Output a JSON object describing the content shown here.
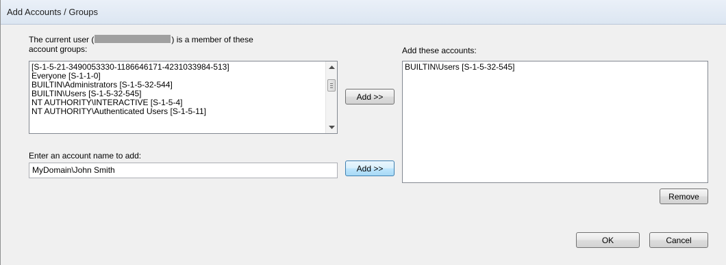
{
  "window": {
    "title": "Add Accounts / Groups"
  },
  "current_groups": {
    "label_prefix": "The current user (",
    "label_suffix": ") is a member of these",
    "label_line2": "account groups:",
    "items": [
      "[S-1-5-21-3490053330-1186646171-4231033984-513]",
      "Everyone [S-1-1-0]",
      "BUILTIN\\Administrators [S-1-5-32-544]",
      "BUILTIN\\Users [S-1-5-32-545]",
      "NT AUTHORITY\\INTERACTIVE [S-1-5-4]",
      "NT AUTHORITY\\Authenticated Users [S-1-5-11]"
    ],
    "add_button": "Add >>"
  },
  "account_name": {
    "label": "Enter an account name to add:",
    "value": "MyDomain\\John Smith",
    "add_button": "Add >>"
  },
  "add_these": {
    "label": "Add these accounts:",
    "items": [
      "BUILTIN\\Users [S-1-5-32-545]"
    ],
    "remove_button": "Remove"
  },
  "footer": {
    "ok": "OK",
    "cancel": "Cancel"
  }
}
